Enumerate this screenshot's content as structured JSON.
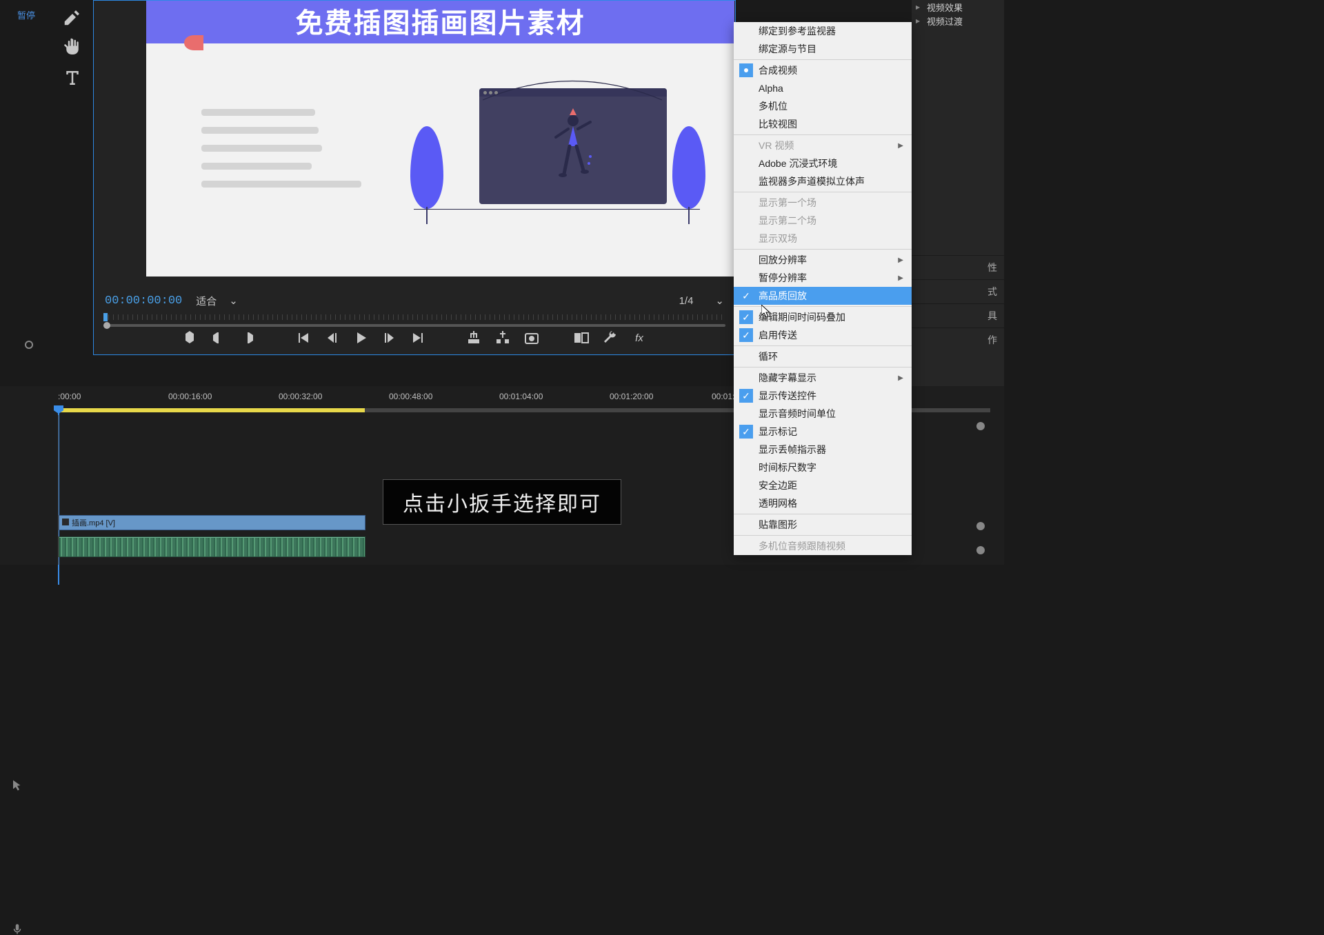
{
  "topbar_label": "暂停",
  "monitor": {
    "timecode": "00:00:00:00",
    "fit_label": "适合",
    "zoom_label": "1/4",
    "viewport_title": "免费插图插画图片素材"
  },
  "timeline": {
    "ticks": [
      ":00:00",
      "00:00:16:00",
      "00:00:32:00",
      "00:00:48:00",
      "00:01:04:00",
      "00:01:20:00",
      "00:01:"
    ],
    "clip_video_label": "插画.mp4 [V]"
  },
  "subtitle": "点击小扳手选择即可",
  "right_panel": {
    "items": [
      "视频效果",
      "视频过渡"
    ],
    "tabs": [
      "性",
      "式",
      "具",
      "作"
    ]
  },
  "context_menu": [
    {
      "label": "绑定到参考监视器",
      "type": "item"
    },
    {
      "label": "绑定源与节目",
      "type": "item"
    },
    {
      "type": "sep"
    },
    {
      "label": "合成视频",
      "type": "radio"
    },
    {
      "label": "Alpha",
      "type": "item"
    },
    {
      "label": "多机位",
      "type": "item"
    },
    {
      "label": "比较视图",
      "type": "item"
    },
    {
      "type": "sep"
    },
    {
      "label": "VR 视频",
      "type": "submenu",
      "disabled": true
    },
    {
      "label": "Adobe 沉浸式环境",
      "type": "item"
    },
    {
      "label": "监视器多声道模拟立体声",
      "type": "item"
    },
    {
      "type": "sep"
    },
    {
      "label": "显示第一个场",
      "type": "item",
      "disabled": true
    },
    {
      "label": "显示第二个场",
      "type": "item",
      "disabled": true
    },
    {
      "label": "显示双场",
      "type": "item",
      "disabled": true
    },
    {
      "type": "sep"
    },
    {
      "label": "回放分辨率",
      "type": "submenu"
    },
    {
      "label": "暂停分辨率",
      "type": "submenu"
    },
    {
      "label": "高品质回放",
      "type": "check",
      "checked": true,
      "highlight": true
    },
    {
      "type": "sep"
    },
    {
      "label": "编辑期间时间码叠加",
      "type": "check",
      "checked": true
    },
    {
      "label": "启用传送",
      "type": "check",
      "checked": true
    },
    {
      "type": "sep"
    },
    {
      "label": "循环",
      "type": "item"
    },
    {
      "type": "sep"
    },
    {
      "label": "隐藏字幕显示",
      "type": "submenu"
    },
    {
      "label": "显示传送控件",
      "type": "check",
      "checked": true
    },
    {
      "label": "显示音频时间单位",
      "type": "item"
    },
    {
      "label": "显示标记",
      "type": "check",
      "checked": true
    },
    {
      "label": "显示丢帧指示器",
      "type": "item"
    },
    {
      "label": "时间标尺数字",
      "type": "item"
    },
    {
      "label": "安全边距",
      "type": "item"
    },
    {
      "label": "透明网格",
      "type": "item"
    },
    {
      "type": "sep"
    },
    {
      "label": "贴靠图形",
      "type": "item"
    },
    {
      "type": "sep"
    },
    {
      "label": "多机位音频跟随视频",
      "type": "item",
      "disabled": true
    }
  ]
}
